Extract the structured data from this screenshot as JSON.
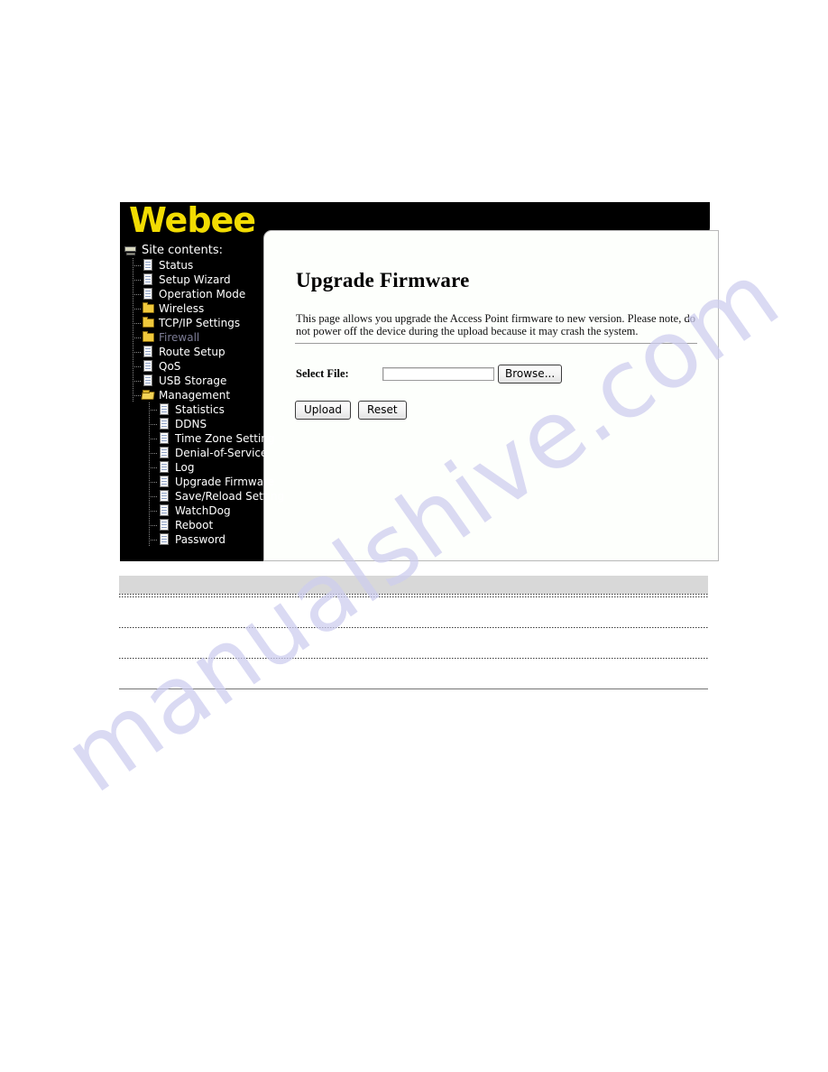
{
  "brand": {
    "logo_text": "Webee",
    "logo_color": "#f2dc02",
    "banner_color": "#000000"
  },
  "sidebar": {
    "root_label": "Site contents:",
    "root_icon": "computer-icon",
    "items": [
      {
        "label": "Status",
        "icon": "page-icon",
        "level": 1,
        "muted": false
      },
      {
        "label": "Setup Wizard",
        "icon": "page-icon",
        "level": 1,
        "muted": false
      },
      {
        "label": "Operation Mode",
        "icon": "page-icon",
        "level": 1,
        "muted": false
      },
      {
        "label": "Wireless",
        "icon": "folder-icon",
        "level": 1,
        "muted": false
      },
      {
        "label": "TCP/IP Settings",
        "icon": "folder-icon",
        "level": 1,
        "muted": false
      },
      {
        "label": "Firewall",
        "icon": "folder-icon",
        "level": 1,
        "muted": true
      },
      {
        "label": "Route Setup",
        "icon": "page-icon",
        "level": 1,
        "muted": false
      },
      {
        "label": "QoS",
        "icon": "page-icon",
        "level": 1,
        "muted": false
      },
      {
        "label": "USB Storage",
        "icon": "page-icon",
        "level": 1,
        "muted": false
      },
      {
        "label": "Management",
        "icon": "folder-open-icon",
        "level": 1,
        "muted": false
      },
      {
        "label": "Statistics",
        "icon": "page-icon",
        "level": 2,
        "muted": false
      },
      {
        "label": "DDNS",
        "icon": "page-icon",
        "level": 2,
        "muted": false
      },
      {
        "label": "Time Zone Setting",
        "icon": "page-icon",
        "level": 2,
        "muted": false
      },
      {
        "label": "Denial-of-Service",
        "icon": "page-icon",
        "level": 2,
        "muted": false
      },
      {
        "label": "Log",
        "icon": "page-icon",
        "level": 2,
        "muted": false
      },
      {
        "label": "Upgrade Firmware",
        "icon": "page-icon",
        "level": 2,
        "muted": false
      },
      {
        "label": "Save/Reload Setting",
        "icon": "page-icon",
        "level": 2,
        "muted": false
      },
      {
        "label": "WatchDog",
        "icon": "page-icon",
        "level": 2,
        "muted": false
      },
      {
        "label": "Reboot",
        "icon": "page-icon",
        "level": 2,
        "muted": false
      },
      {
        "label": "Password",
        "icon": "page-icon",
        "level": 2,
        "muted": false
      }
    ]
  },
  "main": {
    "title": "Upgrade Firmware",
    "description": "This page allows you upgrade the Access Point firmware to new version. Please note, do not power off the device during the upload because it may crash the system.",
    "form": {
      "select_file_label": "Select File:",
      "file_value": "",
      "file_placeholder": "",
      "browse_label": "Browse..."
    },
    "actions": {
      "upload_label": "Upload",
      "reset_label": "Reset"
    }
  },
  "watermark": {
    "text": "manualshive.com",
    "color": "#cdcdef"
  }
}
